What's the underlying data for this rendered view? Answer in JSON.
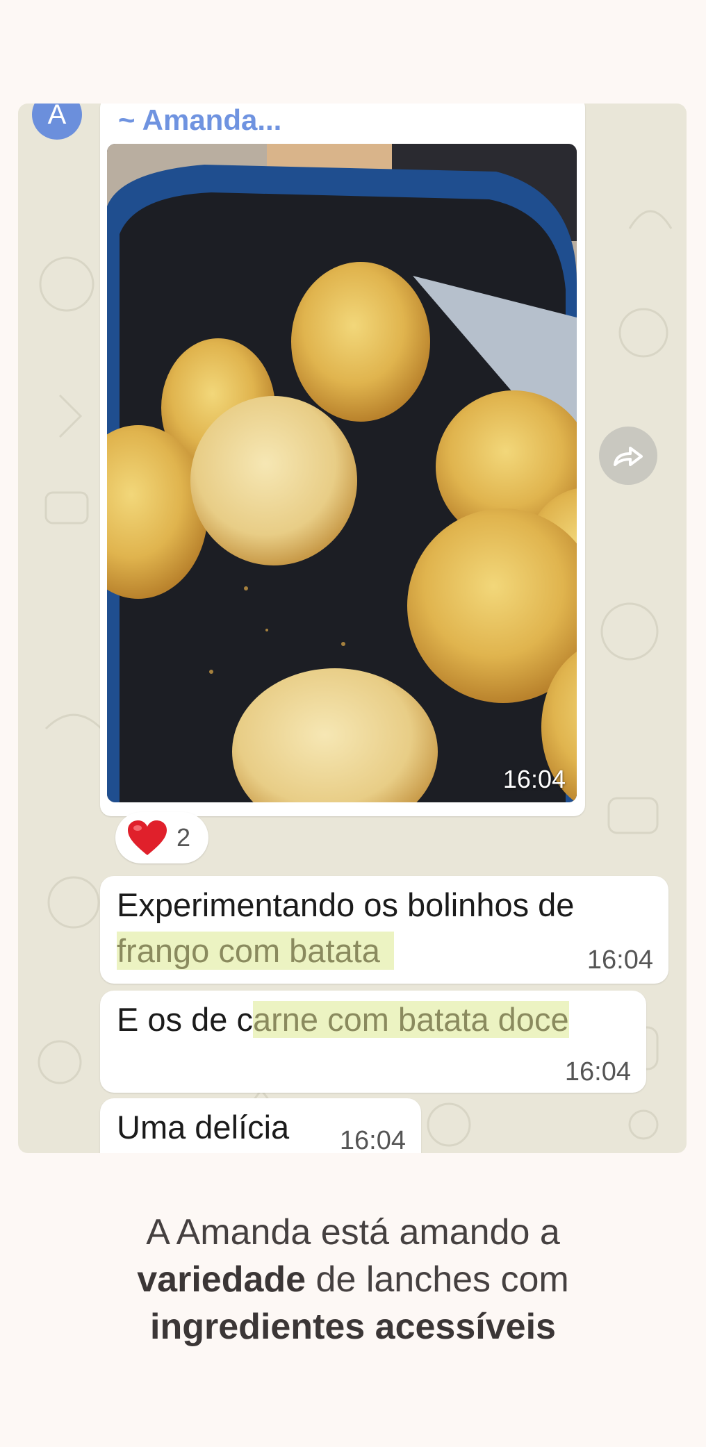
{
  "chat": {
    "avatar_letter": "A",
    "sender": "~ Amanda...",
    "photo_time": "16:04",
    "reaction": {
      "emoji_icon": "heart-emoji",
      "count": "2"
    },
    "messages": [
      {
        "line1": "Experimentando os bolinhos de",
        "line2": "frango com batata",
        "time": "16:04"
      },
      {
        "plain": "E os de c",
        "highlight": "arne com batata doce",
        "time": "16:04"
      },
      {
        "text": "Uma delícia",
        "time": "16:04"
      }
    ],
    "forward_icon": "forward-icon"
  },
  "caption": {
    "line1": "A Amanda está amando a",
    "bold1": "variedade",
    "line2_rest": " de lanches com",
    "bold2": "ingredientes acessíveis"
  }
}
